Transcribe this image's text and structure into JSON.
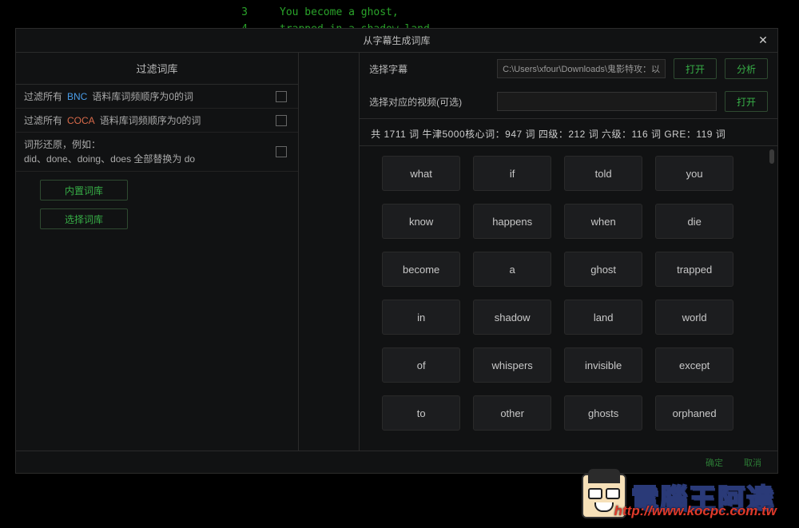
{
  "bg_lines": [
    {
      "n": 3,
      "t": "You become a ghost,"
    },
    {
      "n": 4,
      "t": "trapped in a shadow land"
    }
  ],
  "dialog": {
    "title": "从字幕生成词库",
    "left": {
      "heading": "过滤词库",
      "filter_bnc": {
        "pre": "过滤所有",
        "hl": "BNC",
        "post": "语料库词频顺序为0的词"
      },
      "filter_coca": {
        "pre": "过滤所有",
        "hl": "COCA",
        "post": "语料库词频顺序为0的词"
      },
      "lemma": {
        "line1": "词形还原，例如：",
        "line2": "did、done、doing、does 全部替换为 do"
      },
      "btn_builtin": "内置词库",
      "btn_select": "选择词库"
    },
    "right": {
      "subtitle_label": "选择字幕",
      "subtitle_path": "C:\\Users\\xfour\\Downloads\\鬼影特攻：以",
      "video_label": "选择对应的视频(可选)",
      "video_path": "",
      "btn_open": "打开",
      "btn_analyze": "分析",
      "stats": "共 1711 词   牛津5000核心词：947 词   四级：212 词   六级：116 词   GRE：119 词",
      "words": [
        "what",
        "if",
        "told",
        "you",
        "know",
        "happens",
        "when",
        "die",
        "become",
        "a",
        "ghost",
        "trapped",
        "in",
        "shadow",
        "land",
        "world",
        "of",
        "whispers",
        "invisible",
        "except",
        "to",
        "other",
        "ghosts",
        "orphaned"
      ]
    },
    "footer": {
      "a": "确定",
      "b": "取消"
    }
  },
  "watermark": {
    "text": "電腦王阿達",
    "url": "http://www.kocpc.com.tw"
  }
}
